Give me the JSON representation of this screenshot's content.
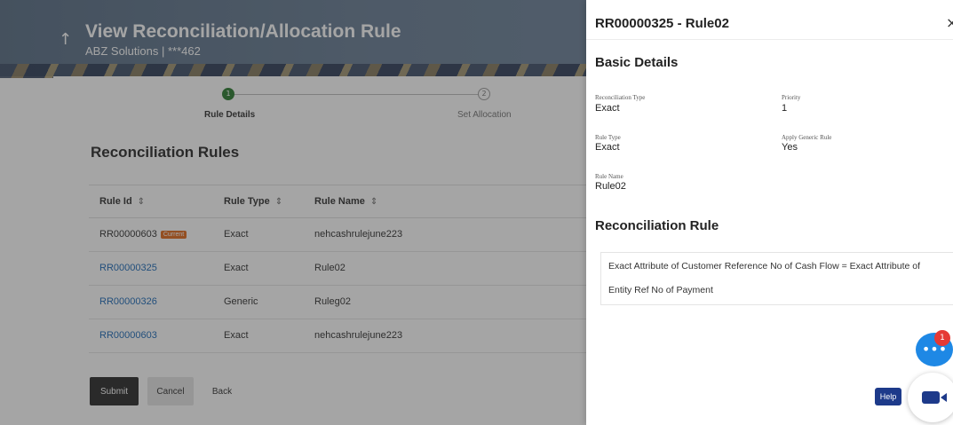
{
  "header": {
    "title": "View Reconciliation/Allocation Rule",
    "subtitle": "ABZ Solutions | ***462"
  },
  "stepper": {
    "steps": [
      {
        "number": "1",
        "label": "Rule Details"
      },
      {
        "number": "2",
        "label": "Set Allocation"
      }
    ]
  },
  "rules_section": {
    "title": "Reconciliation Rules",
    "columns": [
      "Rule Id",
      "Rule Type",
      "Rule Name"
    ],
    "rows": [
      {
        "id": "RR00000603",
        "badge": "Current",
        "type": "Exact",
        "name": "nehcashrulejune223"
      },
      {
        "id": "RR00000325",
        "badge": "",
        "type": "Exact",
        "name": "Rule02"
      },
      {
        "id": "RR00000326",
        "badge": "",
        "type": "Generic",
        "name": "Ruleg02"
      },
      {
        "id": "RR00000603",
        "badge": "",
        "type": "Exact",
        "name": "nehcashrulejune223"
      }
    ]
  },
  "actions": {
    "submit": "Submit",
    "cancel": "Cancel",
    "back": "Back"
  },
  "drawer": {
    "title": "RR00000325 - Rule02",
    "close": "×",
    "basic_details_heading": "Basic Details",
    "fields": {
      "reconciliation_type": {
        "label": "Reconciliation Type",
        "value": "Exact"
      },
      "priority": {
        "label": "Priority",
        "value": "1"
      },
      "rule_type": {
        "label": "Rule Type",
        "value": "Exact"
      },
      "apply_generic_rule": {
        "label": "Apply Generic Rule",
        "value": "Yes"
      },
      "rule_name": {
        "label": "Rule Name",
        "value": "Rule02"
      }
    },
    "reconciliation_rule_heading": "Reconciliation Rule",
    "rule_text_line1": "Exact Attribute of Customer Reference No of Cash Flow = Exact Attribute of",
    "rule_text_line2": "Entity Ref No of Payment"
  },
  "widgets": {
    "chat_badge_count": "1",
    "help_label": "Help"
  },
  "colors": {
    "link": "#1e6bb8",
    "badge": "#e26b1e",
    "step_active": "#2e7d32",
    "chat": "#1e88e5",
    "notification": "#e53935",
    "brand_dark": "#1d3a8a"
  },
  "icons": [
    "back-arrow-icon",
    "sort-icon",
    "close-icon",
    "chat-icon",
    "video-call-icon"
  ]
}
